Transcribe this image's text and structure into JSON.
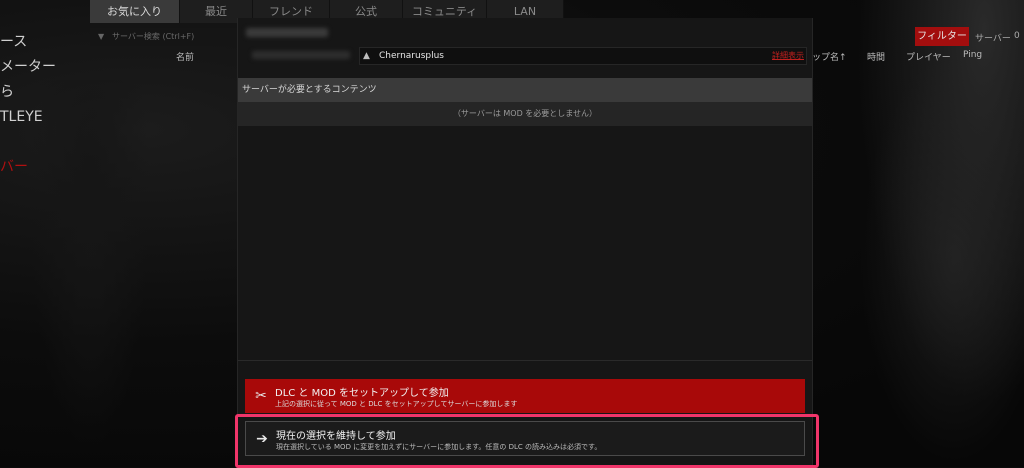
{
  "tabs": [
    {
      "label": "お気に入り",
      "active": true
    },
    {
      "label": "最近",
      "active": false
    },
    {
      "label": "フレンド",
      "active": false
    },
    {
      "label": "公式",
      "active": false
    },
    {
      "label": "コミュニティ",
      "active": false
    },
    {
      "label": "LAN",
      "active": false
    }
  ],
  "sidebar": {
    "items": [
      "ース",
      "メーター",
      "ら",
      "TLEYE"
    ],
    "active_item": "バー"
  },
  "search": {
    "placeholder": "サーバー検索 (Ctrl+F)"
  },
  "columns": {
    "name": "名前",
    "map": "ップ名↑",
    "time": "時間",
    "players": "プレイヤー",
    "ping": "Ping"
  },
  "filter": {
    "label": "フィルター"
  },
  "server_count": {
    "label": "サーバー",
    "value": "0"
  },
  "dialog": {
    "map_name": "Chernarusplus",
    "details_link": "詳細表示",
    "content_header": "サーバーが必要とするコンテンツ",
    "no_mod_text": "（サーバーは MOD を必要としません）",
    "setup_button": {
      "title": "DLC と MOD をセットアップして参加",
      "subtitle": "上記の選択に従って MOD と DLC をセットアップしてサーバーに参加します",
      "icon": "tools-icon"
    },
    "keep_button": {
      "title": "現在の選択を維持して参加",
      "subtitle": "現在選択している MOD に変更を加えずにサーバーに参加します。任意の DLC の読み込みは必須です。",
      "icon": "arrow-right-icon"
    }
  },
  "colors": {
    "accent_red": "#a80909",
    "highlight": "#f0356a",
    "link_red": "#c0201e"
  }
}
